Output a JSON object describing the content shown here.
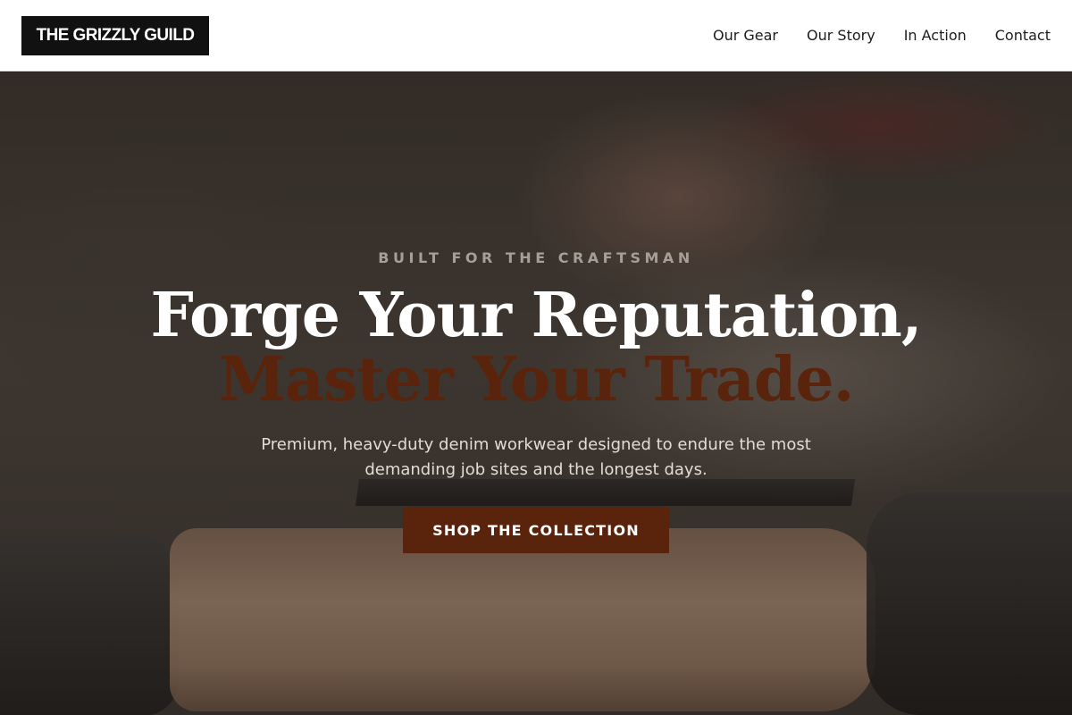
{
  "header": {
    "logo": "THE GRIZZLY GUILD",
    "nav": [
      {
        "label": "Our Gear"
      },
      {
        "label": "Our Story"
      },
      {
        "label": "In Action"
      },
      {
        "label": "Contact"
      }
    ]
  },
  "hero": {
    "eyebrow": "BUILT FOR THE CRAFTSMAN",
    "headline_line1": "Forge Your Reputation,",
    "headline_line2": "Master Your Trade.",
    "subtext": "Premium, heavy-duty denim workwear designed to endure the most demanding job sites and the longest days.",
    "cta_label": "SHOP THE COLLECTION",
    "background_image": "woodworker-lathe-photo"
  },
  "colors": {
    "accent": "#5a230b",
    "logo_bg": "#111111",
    "header_bg": "#ffffff"
  }
}
